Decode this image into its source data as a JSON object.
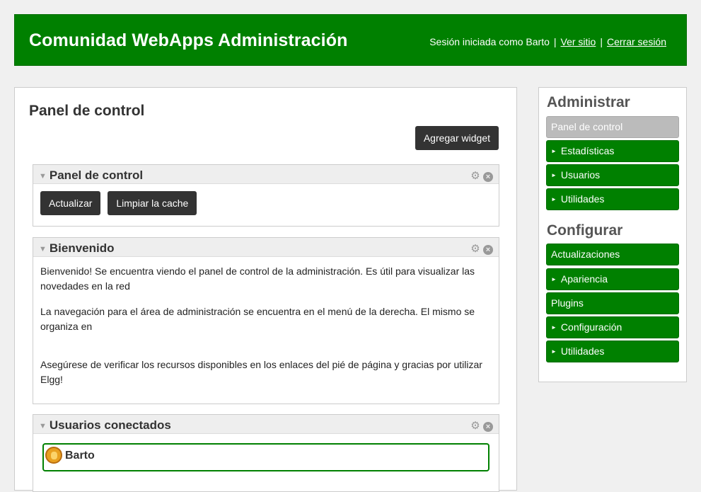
{
  "header": {
    "title": "Comunidad WebApps Administración",
    "session_text": "Sesión iniciada como Barto",
    "view_site": "Ver sitio",
    "logout": "Cerrar sesión",
    "separator": "|",
    "background_color": "#008000"
  },
  "main": {
    "title": "Panel de control",
    "add_widget": "Agregar widget",
    "widgets": [
      {
        "title": "Panel de control",
        "buttons": [
          "Actualizar",
          "Limpiar la cache"
        ]
      },
      {
        "title": "Bienvenido",
        "paragraphs": [
          "Bienvenido! Se encuentra viendo el panel de control de la administración. Es útil para visualizar las novedades en la red",
          "La navegación para el área de administración se encuentra en el menú de la derecha. El mismo se organiza en",
          "Asegúrese de verificar los recursos disponibles en los enlaces del pié de página y gracias por utilizar Elgg!"
        ]
      },
      {
        "title": "Usuarios conectados",
        "users": [
          "Barto"
        ]
      }
    ],
    "icons": {
      "collapse": "collapse-arrow-icon",
      "settings": "gear-icon",
      "close": "close-icon"
    }
  },
  "sidebar": {
    "administer_heading": "Administrar",
    "administer_items": [
      {
        "label": "Panel de control",
        "selected": true,
        "arrow": false
      },
      {
        "label": "Estadísticas",
        "selected": false,
        "arrow": true
      },
      {
        "label": "Usuarios",
        "selected": false,
        "arrow": true
      },
      {
        "label": "Utilidades",
        "selected": false,
        "arrow": true
      }
    ],
    "configure_heading": "Configurar",
    "configure_items": [
      {
        "label": "Actualizaciones",
        "selected": false,
        "arrow": false
      },
      {
        "label": "Apariencia",
        "selected": false,
        "arrow": true
      },
      {
        "label": "Plugins",
        "selected": false,
        "arrow": false
      },
      {
        "label": "Configuración",
        "selected": false,
        "arrow": true
      },
      {
        "label": "Utilidades",
        "selected": false,
        "arrow": true
      }
    ],
    "accent_color": "#008000",
    "selected_color": "#bbbbbb"
  }
}
